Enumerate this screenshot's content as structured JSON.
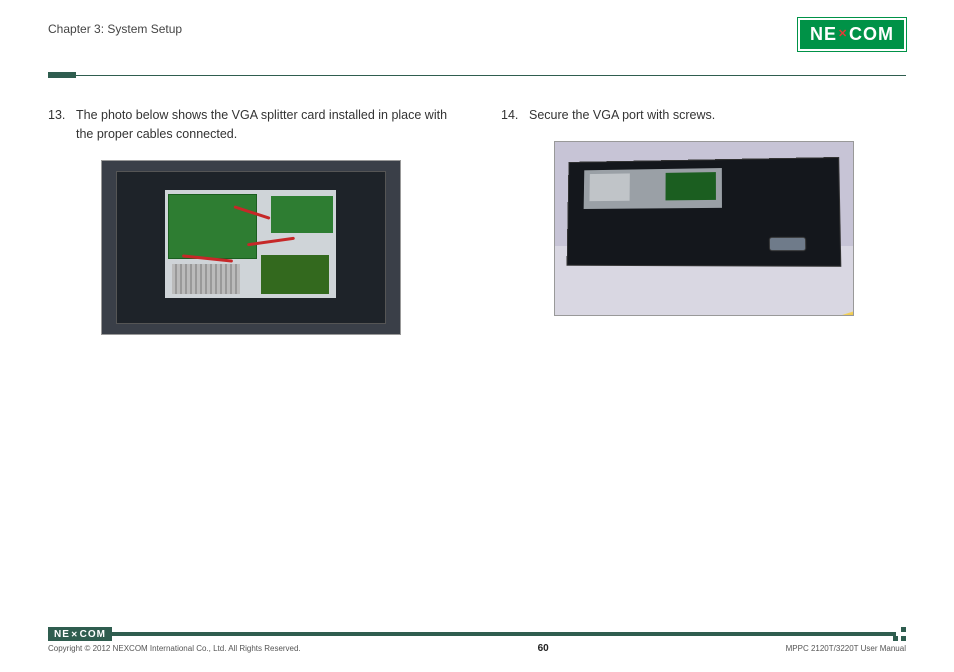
{
  "header": {
    "chapter": "Chapter 3: System Setup",
    "logoText": "NEXCOM"
  },
  "steps": [
    {
      "num": "13.",
      "text": "The photo below shows the VGA splitter card installed in place with the proper cables connected."
    },
    {
      "num": "14.",
      "text": "Secure the VGA port with screws."
    }
  ],
  "footer": {
    "logoText": "NEXCOM",
    "copyright": "Copyright © 2012 NEXCOM International Co., Ltd. All Rights Reserved.",
    "pageNumber": "60",
    "manualRef": "MPPC 2120T/3220T User Manual"
  }
}
